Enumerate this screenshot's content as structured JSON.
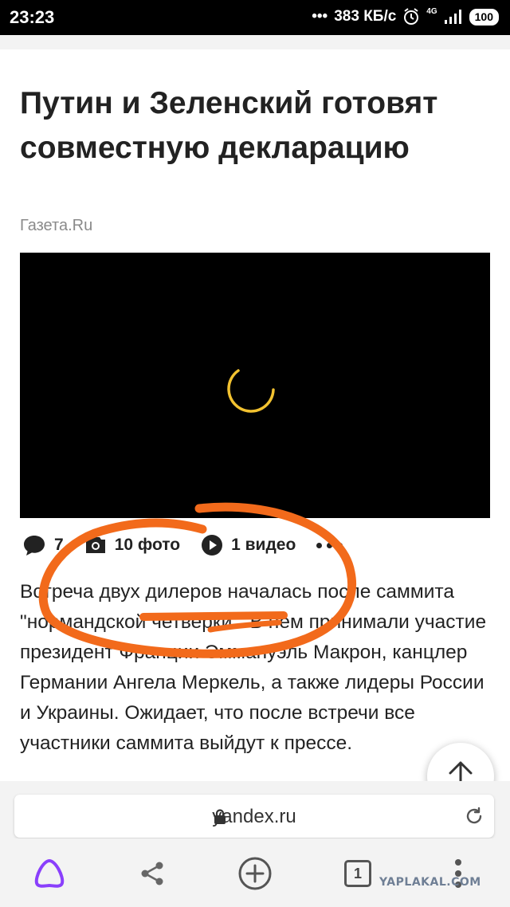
{
  "status_bar": {
    "time": "23:23",
    "speed": "383 КБ/с",
    "network": "4G",
    "battery": "100"
  },
  "article": {
    "title": "Путин и Зеленский готовят совместную декларацию",
    "source": "Газета.Ru",
    "comments": "7",
    "photos": "10 фото",
    "videos": "1 видео",
    "body": "Встреча двух дилеров началась после саммита \"нормандской четверки\". В нем принимали участие президент Франции Эммануэль Макрон, канцлер Германии Ангела Меркель, а также лидеры России и Украины. Ожидает, что после встречи все участники саммита выйдут к прессе."
  },
  "browser": {
    "url": "yandex.ru",
    "tab_count": "1"
  },
  "watermark": "YAPLAKAL.COM",
  "colors": {
    "annotation": "#f26a1b",
    "spinner": "#f2c230",
    "alice": "#8a3ffc"
  }
}
